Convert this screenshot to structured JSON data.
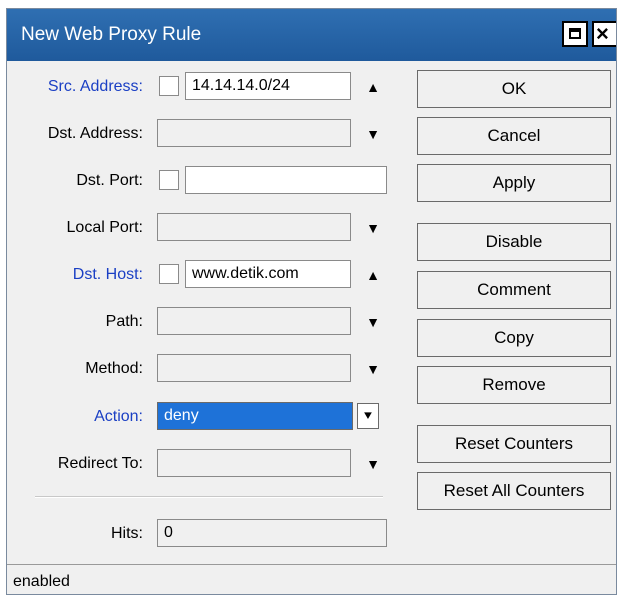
{
  "window": {
    "title": "New Web Proxy Rule"
  },
  "form": {
    "src_address": {
      "label": "Src. Address:",
      "value": "14.14.14.0/24",
      "arrow": "▲"
    },
    "dst_address": {
      "label": "Dst. Address:",
      "value": "",
      "arrow": "▼"
    },
    "dst_port": {
      "label": "Dst. Port:",
      "value": ""
    },
    "local_port": {
      "label": "Local Port:",
      "value": "",
      "arrow": "▼"
    },
    "dst_host": {
      "label": "Dst. Host:",
      "value": "www.detik.com",
      "arrow": "▲"
    },
    "path": {
      "label": "Path:",
      "value": "",
      "arrow": "▼"
    },
    "method": {
      "label": "Method:",
      "value": "",
      "arrow": "▼"
    },
    "action": {
      "label": "Action:",
      "value": "deny",
      "dropdown_glyph": "⯆"
    },
    "redirect_to": {
      "label": "Redirect To:",
      "value": "",
      "arrow": "▼"
    },
    "hits": {
      "label": "Hits:",
      "value": "0"
    }
  },
  "buttons": {
    "ok": "OK",
    "cancel": "Cancel",
    "apply": "Apply",
    "disable": "Disable",
    "comment": "Comment",
    "copy": "Copy",
    "remove": "Remove",
    "reset_counters": "Reset Counters",
    "reset_all_counters": "Reset All Counters"
  },
  "status": {
    "text": "enabled"
  },
  "colors": {
    "titlebar": "#2f6fb2",
    "label_highlight": "#1a3fc4",
    "selection": "#1e72d8"
  }
}
